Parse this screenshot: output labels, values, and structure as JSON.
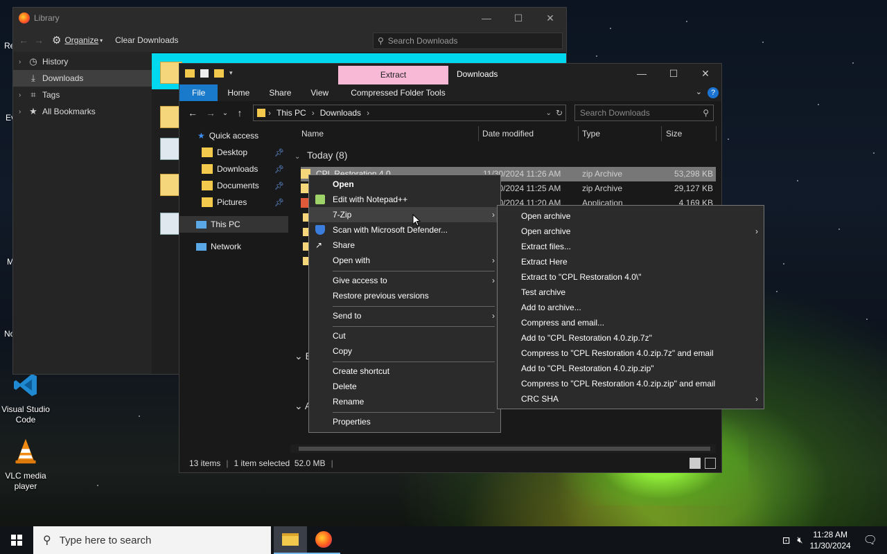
{
  "desktop": {
    "icons": [
      {
        "label": "Visual Studio\nCode"
      },
      {
        "label": "VLC media\nplayer"
      }
    ],
    "edge_fragments": [
      "Re",
      "Ev",
      "M",
      "No"
    ]
  },
  "library": {
    "title": "Library",
    "toolbar": {
      "organize": "Organize",
      "clear": "Clear Downloads"
    },
    "search_placeholder": "Search Downloads",
    "sidebar": [
      {
        "label": "History"
      },
      {
        "label": "Downloads"
      },
      {
        "label": "Tags"
      },
      {
        "label": "All Bookmarks"
      }
    ]
  },
  "explorer": {
    "context_tab": "Extract",
    "title": "Downloads",
    "ribbon_tabs": [
      "File",
      "Home",
      "Share",
      "View",
      "Compressed Folder Tools"
    ],
    "address": {
      "crumb1": "This PC",
      "crumb2": "Downloads"
    },
    "search_placeholder": "Search Downloads",
    "nav": {
      "quick_access": "Quick access",
      "items": [
        "Desktop",
        "Downloads",
        "Documents",
        "Pictures"
      ],
      "this_pc": "This PC",
      "network": "Network"
    },
    "columns": {
      "name": "Name",
      "date": "Date modified",
      "type": "Type",
      "size": "Size"
    },
    "group": "Today (8)",
    "rows": [
      {
        "name": "CPL Restoration 4.0",
        "date": "11/30/2024 11:26 AM",
        "type": "zip Archive",
        "size": "53,298 KB"
      },
      {
        "name": "",
        "date": "11/30/2024 11:25 AM",
        "type": "zip Archive",
        "size": "29,127 KB"
      },
      {
        "name": "",
        "date": "11/30/2024 11:20 AM",
        "type": "Application",
        "size": "4,169 KB"
      }
    ],
    "status": {
      "items": "13 items",
      "selected": "1 item selected  52.0 MB"
    }
  },
  "context_menu": {
    "items": [
      {
        "label": "Open",
        "bold": true
      },
      {
        "label": "Edit with Notepad++"
      },
      {
        "label": "7-Zip",
        "submenu": true
      },
      {
        "label": "Scan with Microsoft Defender..."
      },
      {
        "label": "Share"
      },
      {
        "label": "Open with",
        "submenu": true
      },
      {
        "label": "Give access to",
        "submenu": true
      },
      {
        "label": "Restore previous versions"
      },
      {
        "label": "Send to",
        "submenu": true
      },
      {
        "label": "Cut"
      },
      {
        "label": "Copy"
      },
      {
        "label": "Create shortcut"
      },
      {
        "label": "Delete"
      },
      {
        "label": "Rename"
      },
      {
        "label": "Properties"
      }
    ]
  },
  "zip_menu": {
    "items": [
      "Open archive",
      "Open archive",
      "Extract files...",
      "Extract Here",
      "Extract to \"CPL Restoration 4.0\\\"",
      "Test archive",
      "Add to archive...",
      "Compress and email...",
      "Add to \"CPL Restoration 4.0.zip.7z\"",
      "Compress to \"CPL Restoration 4.0.zip.7z\" and email",
      "Add to \"CPL Restoration 4.0.zip.zip\"",
      "Compress to \"CPL Restoration 4.0.zip.zip\" and email",
      "CRC SHA"
    ]
  },
  "taskbar": {
    "search_placeholder": "Type here to search",
    "time": "11:28 AM",
    "date": "11/30/2024"
  },
  "colors": {
    "file_tab": "#1979ca",
    "context_tab": "#f7b9d6",
    "cyan_banner": "#00d8f0"
  }
}
